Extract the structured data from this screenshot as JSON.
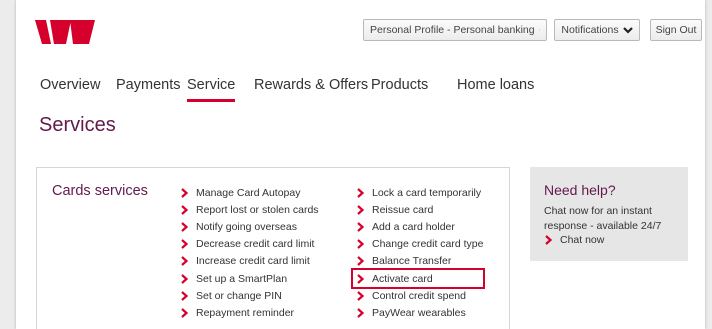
{
  "header": {
    "profile_label": "Personal Profile - Personal banking",
    "notifications_label": "Notifications",
    "signout_label": "Sign Out",
    "brand_color": "#d5002b"
  },
  "nav": {
    "tabs": [
      {
        "label": "Overview"
      },
      {
        "label": "Payments"
      },
      {
        "label": "Service",
        "active": true
      },
      {
        "label": "Rewards & Offers"
      },
      {
        "label": "Products"
      },
      {
        "label": "Home loans"
      }
    ]
  },
  "main": {
    "title": "Services",
    "cards": {
      "heading": "Cards services",
      "col1": [
        "Manage Card Autopay",
        "Report lost or stolen cards",
        "Notify going overseas",
        "Decrease credit card limit",
        "Increase credit card limit",
        "Set up a SmartPlan",
        "Set or change PIN",
        "Repayment reminder"
      ],
      "col2": [
        "Lock a card temporarily",
        "Reissue card",
        "Add a card holder",
        "Change credit card type",
        "Balance Transfer",
        "Activate card",
        "Control credit spend",
        "PayWear wearables"
      ],
      "highlighted_item": "Activate card"
    }
  },
  "help": {
    "title": "Need help?",
    "text": "Chat now for an instant response - available 24/7",
    "link": "Chat now"
  },
  "colors": {
    "accent": "#d5002b",
    "heading": "#621a4b"
  }
}
